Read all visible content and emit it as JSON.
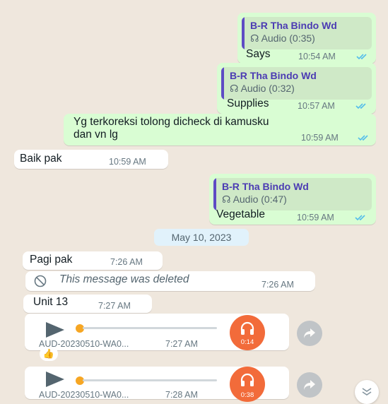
{
  "colors": {
    "background": "#efe7dd",
    "outgoing_bubble": "#d9fdd3",
    "incoming_bubble": "#ffffff",
    "quote_accent": "#5e4bc4",
    "read_ticks": "#53bdeb",
    "audio_avatar": "#f26b3a",
    "progress_dot": "#f6a623"
  },
  "messages": [
    {
      "quote_name": "B-R Tha Bindo Wd",
      "quote_text": "Audio (0:35)",
      "text": "Says",
      "time": "10:54 AM"
    },
    {
      "quote_name": "B-R Tha Bindo Wd",
      "quote_text": "Audio (0:32)",
      "text": "Supplies",
      "time": "10:57 AM"
    },
    {
      "text_line1": "Yg terkoreksi tolong dicheck di kamusku",
      "text_line2": "dan vn lg",
      "time": "10:59 AM"
    },
    {
      "text": "Baik pak",
      "time": "10:59 AM"
    },
    {
      "quote_name": "B-R Tha Bindo Wd",
      "quote_text": "Audio (0:47)",
      "text": "Vegetable",
      "time": "10:59 AM"
    },
    {
      "date": "May 10, 2023"
    },
    {
      "text": "Pagi pak",
      "time": "7:26 AM"
    },
    {
      "text": "This message was deleted",
      "time": "7:26 AM"
    },
    {
      "text": "Unit 13",
      "time": "7:27 AM"
    },
    {
      "filename": "AUD-20230510-WA0...",
      "time": "7:27 AM",
      "duration": "0:14",
      "reaction": "👍"
    },
    {
      "filename": "AUD-20230510-WA0...",
      "time": "7:28 AM",
      "duration": "0:38"
    }
  ],
  "icons": {
    "headphones": "headphones-icon",
    "play": "play-icon",
    "share": "forward-icon",
    "scroll": "chevron-down-icon",
    "deleted": "block-icon",
    "ticks": "double-check-icon"
  }
}
